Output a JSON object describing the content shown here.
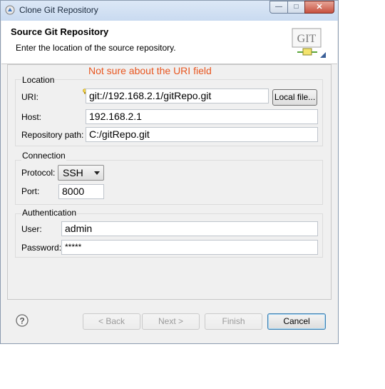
{
  "window": {
    "title": "Clone Git Repository",
    "close_glyph": "✕",
    "min_glyph": "—",
    "max_glyph": "□"
  },
  "header": {
    "title": "Source Git Repository",
    "description": "Enter the location of the source repository.",
    "logo_text": "GIT"
  },
  "annotation": {
    "text": "Not sure about the URI field",
    "color": "#e8561f"
  },
  "location": {
    "group_label": "Location",
    "uri_label": "URI:",
    "uri_value": "git://192.168.2.1/gitRepo.git",
    "local_file_button": "Local file...",
    "host_label": "Host:",
    "host_value": "192.168.2.1",
    "repo_path_label": "Repository path:",
    "repo_path_value": "C:/gitRepo.git"
  },
  "connection": {
    "group_label": "Connection",
    "protocol_label": "Protocol:",
    "protocol_value": "SSH",
    "port_label": "Port:",
    "port_value": "8000"
  },
  "authentication": {
    "group_label": "Authentication",
    "user_label": "User:",
    "user_value": "admin",
    "password_label": "Password:",
    "password_value": "*****"
  },
  "footer": {
    "back_button": "< Back",
    "next_button": "Next >",
    "finish_button": "Finish",
    "cancel_button": "Cancel"
  },
  "icons": [
    "git-app-icon",
    "git-logo-icon",
    "help-icon",
    "content-assist-icon",
    "dropdown-arrow-icon"
  ]
}
